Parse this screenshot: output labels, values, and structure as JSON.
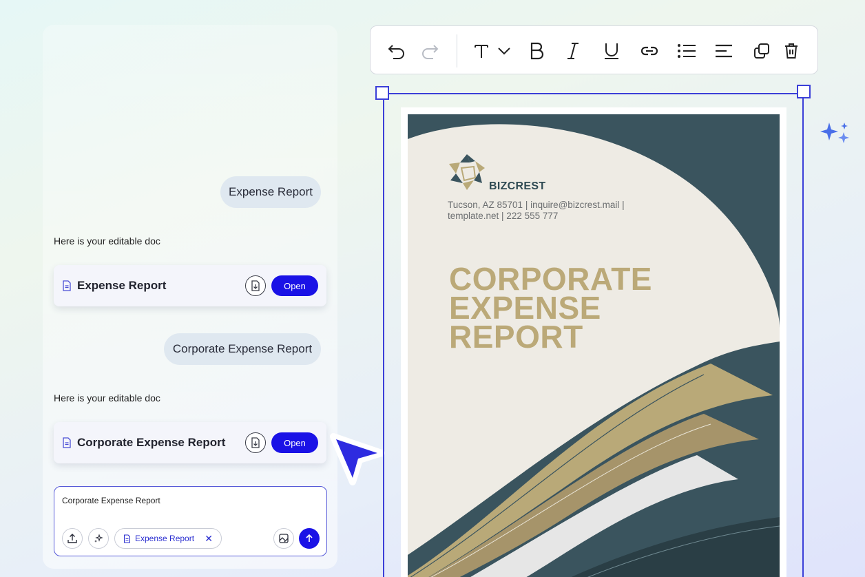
{
  "chat": {
    "messages": [
      {
        "role": "user",
        "text": "Expense Report"
      },
      {
        "role": "assistant",
        "text": "Here is your editable doc",
        "card": {
          "title": "Expense Report",
          "open_label": "Open"
        }
      },
      {
        "role": "user",
        "text": "Corporate Expense Report"
      },
      {
        "role": "assistant",
        "text": "Here is your editable doc",
        "card": {
          "title": "Corporate Expense Report",
          "open_label": "Open"
        }
      }
    ],
    "composer": {
      "value": "Corporate Expense Report",
      "chip_label": "Expense Report",
      "chip_remove": "✕"
    }
  },
  "toolbar": {
    "buttons": [
      "undo-icon",
      "redo-icon",
      "text-style-icon",
      "chevron-down-icon",
      "bold-icon",
      "italic-icon",
      "underline-icon",
      "link-icon",
      "list-icon",
      "align-left-icon",
      "duplicate-icon",
      "delete-icon"
    ]
  },
  "document": {
    "brand": "BIZCREST",
    "contact": "Tucson, AZ 85701 | inquire@bizcrest.mail | template.net | 222 555 777",
    "heading_lines": [
      "CORPORATE",
      "EXPENSE",
      "REPORT"
    ]
  },
  "colors": {
    "accent": "#1a12e6",
    "selection": "#3b3fd8",
    "doc_dark": "#3a545e",
    "doc_gold": "#bba978",
    "doc_cream": "#eeebe4"
  }
}
